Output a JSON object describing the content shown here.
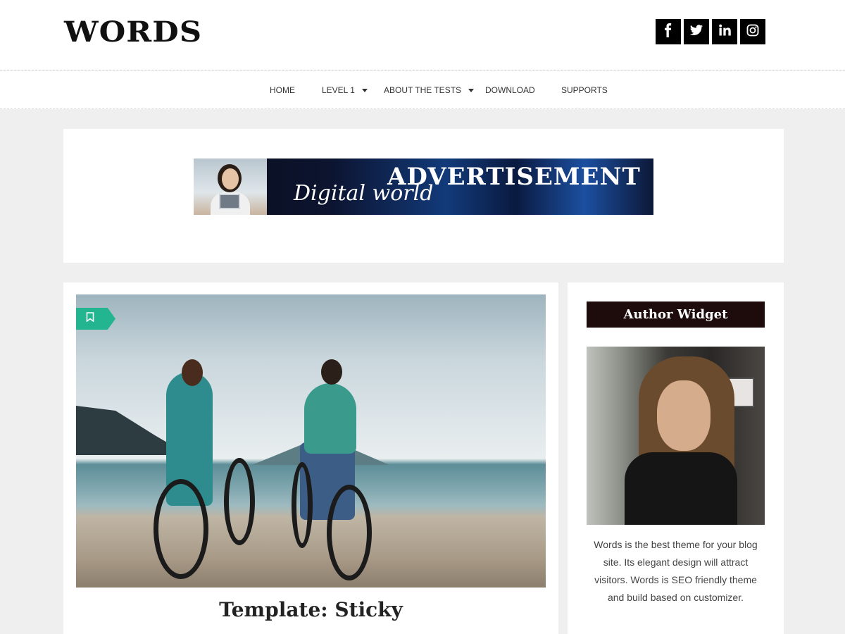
{
  "site": {
    "logo": "WORDS"
  },
  "social": [
    {
      "name": "facebook-icon"
    },
    {
      "name": "twitter-icon"
    },
    {
      "name": "linkedin-icon"
    },
    {
      "name": "instagram-icon"
    }
  ],
  "nav": {
    "items": [
      {
        "label": "HOME",
        "has_dropdown": false
      },
      {
        "label": "LEVEL 1",
        "has_dropdown": true
      },
      {
        "label": "ABOUT THE TESTS",
        "has_dropdown": true
      },
      {
        "label": "DOWNLOAD",
        "has_dropdown": false
      },
      {
        "label": "SUPPORTS",
        "has_dropdown": false
      }
    ]
  },
  "ad": {
    "title": "ADVERTISEMENT",
    "subtitle": "Digital world"
  },
  "post": {
    "title": "Template: Sticky",
    "badge_icon": "bookmark-icon",
    "badge_color": "#23b58f"
  },
  "sidebar": {
    "widget_title": "Author Widget",
    "author_text": "Words is the best theme for your blog site. Its elegant design will attract visitors. Words is SEO friendly theme and build based on customizer."
  },
  "colors": {
    "page_bg": "#efefef",
    "widget_title_bg": "#1e0c0c",
    "social_bg": "#000000"
  }
}
